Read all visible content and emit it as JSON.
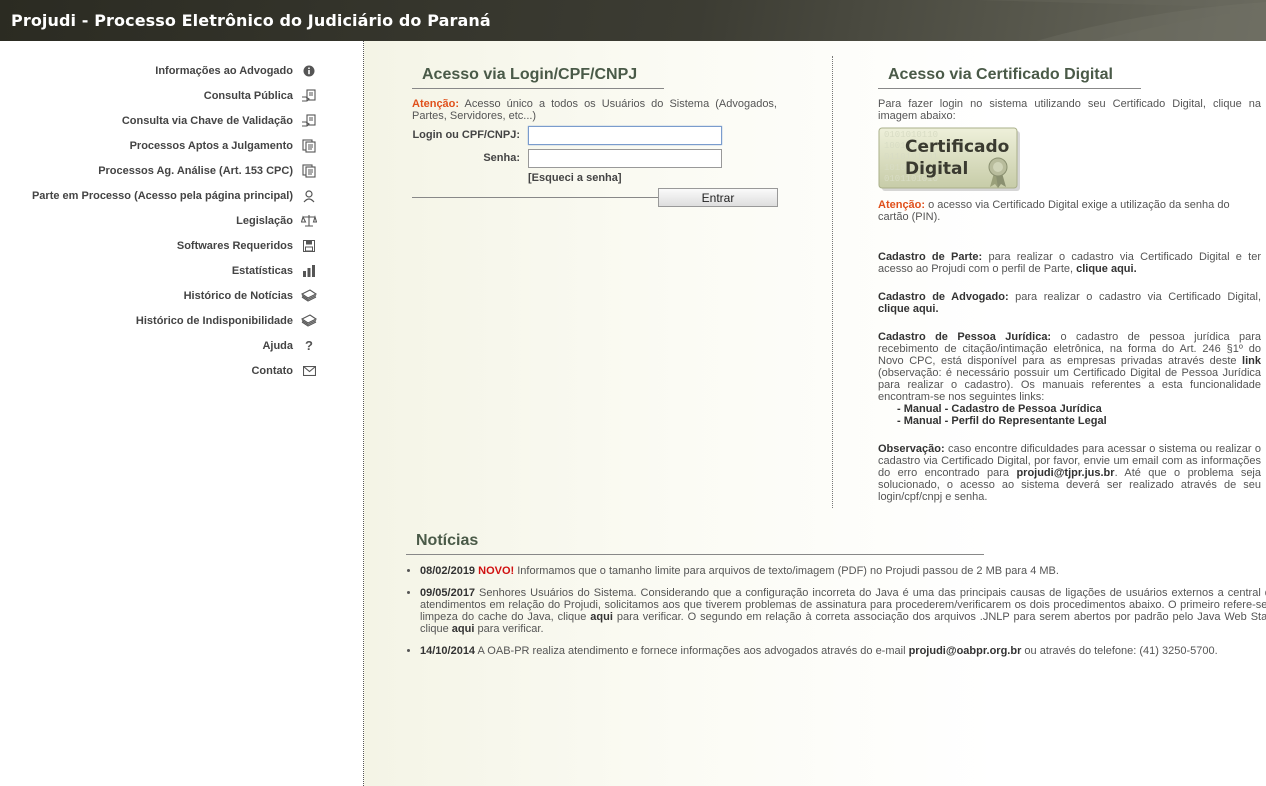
{
  "header": {
    "title": "Projudi - Processo Eletrônico do Judiciário do Paraná"
  },
  "sidebar": {
    "items": [
      {
        "label": "Informações ao Advogado",
        "icon": "info-icon"
      },
      {
        "label": "Consulta Pública",
        "icon": "hand-document-icon"
      },
      {
        "label": "Consulta via Chave de Validação",
        "icon": "hand-document-icon"
      },
      {
        "label": "Processos Aptos a Julgamento",
        "icon": "documents-icon"
      },
      {
        "label": "Processos Ag. Análise (Art. 153 CPC)",
        "icon": "documents-icon"
      },
      {
        "label": "Parte em Processo (Acesso pela página principal)",
        "icon": "person-icon"
      },
      {
        "label": "Legislação",
        "icon": "scales-icon"
      },
      {
        "label": "Softwares Requeridos",
        "icon": "floppy-icon"
      },
      {
        "label": "Estatísticas",
        "icon": "bar-chart-icon"
      },
      {
        "label": "Histórico de Notícias",
        "icon": "stack-icon"
      },
      {
        "label": "Histórico de Indisponibilidade",
        "icon": "stack-icon"
      },
      {
        "label": "Ajuda",
        "icon": "question-icon"
      },
      {
        "label": "Contato",
        "icon": "envelope-icon"
      }
    ]
  },
  "login": {
    "title": "Acesso via Login/CPF/CNPJ",
    "atencao_label": "Atenção:",
    "atencao_text": " Acesso único a todos os Usuários do Sistema (Advogados, Partes, Servidores, etc...)",
    "login_label": "Login ou CPF/CNPJ:",
    "login_value": "",
    "senha_label": "Senha:",
    "senha_value": "",
    "forgot": "[Esqueci a senha]",
    "submit": "Entrar"
  },
  "certificado": {
    "title": "Acesso via Certificado Digital",
    "intro": "Para fazer login no sistema utilizando seu Certificado Digital, clique na imagem abaixo:",
    "image_line1": "Certificado",
    "image_line2": "Digital",
    "image_binary": [
      "0101010110",
      "1001011010",
      "0110101001",
      "1010010110",
      "0101101010"
    ],
    "atencao_label": "Atenção:",
    "atencao_text": " o acesso via Certificado Digital exige a utilização da senha do cartão (PIN).",
    "parte_label": "Cadastro de Parte:",
    "parte_text": " para realizar o cadastro via Certificado Digital e ter acesso ao Projudi com o perfil de Parte, ",
    "parte_link": "clique aqui.",
    "advogado_label": "Cadastro de Advogado:",
    "advogado_text": " para realizar o cadastro via Certificado Digital, ",
    "advogado_link": "clique aqui.",
    "pj_label": "Cadastro de Pessoa Jurídica:",
    "pj_text1": " o cadastro de pessoa jurídica para recebimento de citação/intimação eletrônica, na forma do Art. 246 §1º do Novo CPC, está disponível para as empresas privadas através deste ",
    "pj_link": "link",
    "pj_text2": " (observação: é necessário possuir um Certificado Digital de Pessoa Jurídica para realizar o cadastro). Os manuais referentes a esta funcionalidade encontram-se nos seguintes links:",
    "manual1": "- Manual - Cadastro de Pessoa Jurídica",
    "manual2": "- Manual - Perfil do Representante Legal",
    "obs_label": "Observação:",
    "obs_text1": " caso encontre dificuldades para acessar o sistema ou realizar o cadastro via Certificado Digital, por favor, envie um email com as informações do erro encontrado para ",
    "obs_email": "projudi@tjpr.jus.br",
    "obs_text2": ". Até que o problema seja solucionado, o acesso ao sistema deverá ser realizado através de seu login/cpf/cnpj e senha."
  },
  "noticias": {
    "title": "Notícias",
    "items": [
      {
        "date": "08/02/2019",
        "badge": "NOVO!",
        "text": " Informamos que o tamanho limite para arquivos de texto/imagem (PDF) no Projudi passou de 2 MB para 4 MB."
      },
      {
        "date": "09/05/2017",
        "text1": " Senhores Usuários do Sistema. Considerando que a configuração incorreta do Java é uma das principais causas de ligações de usuários externos a central de atendimentos em relação do Projudi, solicitamos aos que tiverem problemas de assinatura para procederem/verificarem os dois procedimentos abaixo. O primeiro refere-se à limpeza do cache do Java, clique ",
        "link1": "aqui",
        "text2": " para verificar. O segundo em relação à correta associação dos arquivos .JNLP para serem abertos por padrão pelo Java Web Start, clique ",
        "link2": "aqui",
        "text3": " para verificar."
      },
      {
        "date": "14/10/2014",
        "text1": " A OAB-PR realiza atendimento e fornece informações aos advogados através do e-mail ",
        "email": "projudi@oabpr.org.br",
        "text2": " ou através do telefone: (41) 3250-5700."
      }
    ]
  }
}
